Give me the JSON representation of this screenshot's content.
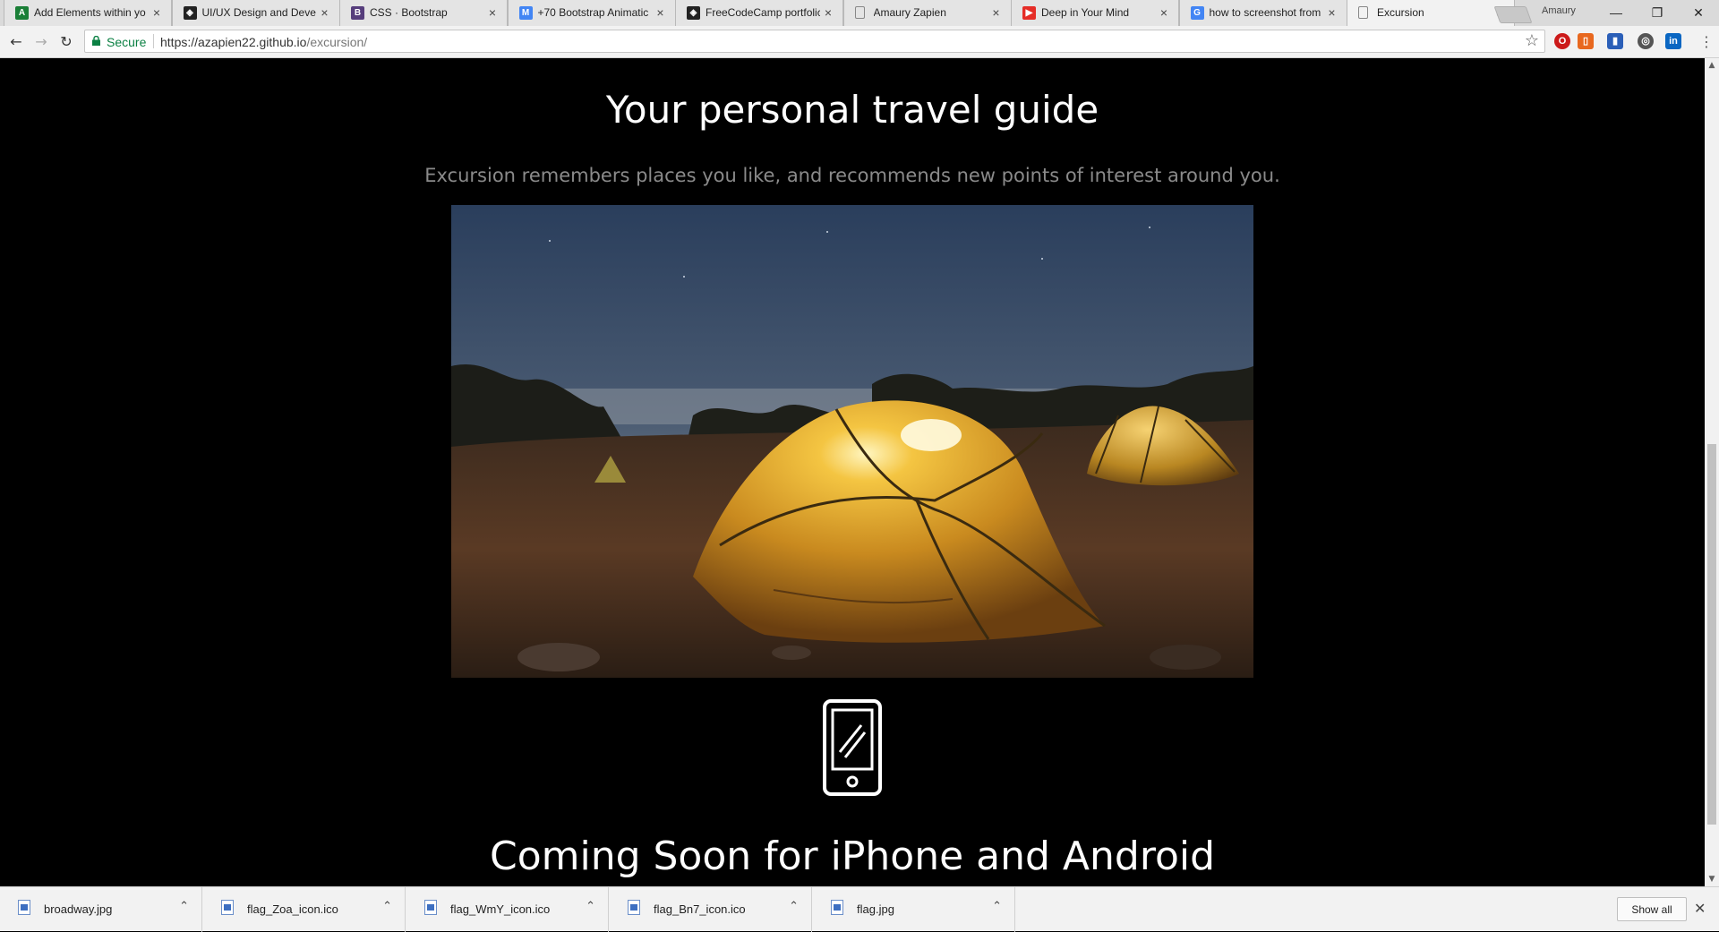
{
  "browser": {
    "tabs": [
      {
        "title": "Add Elements within yo",
        "favicon": "green-spreadsheet-icon",
        "color": "#1a7f37",
        "glyph": "A"
      },
      {
        "title": "UI/UX Design and Deve",
        "favicon": "codepen-icon",
        "color": "#222222",
        "glyph": "◈"
      },
      {
        "title": "CSS · Bootstrap",
        "favicon": "bootstrap-icon",
        "color": "#563d7c",
        "glyph": "B"
      },
      {
        "title": "+70 Bootstrap Animatic",
        "favicon": "mdb-icon",
        "color": "#4285f4",
        "glyph": "M"
      },
      {
        "title": "FreeCodeCamp portfolic",
        "favicon": "codepen-icon",
        "color": "#222222",
        "glyph": "◈"
      },
      {
        "title": "Amaury Zapien",
        "favicon": "page-icon",
        "color": "#888888",
        "glyph": ""
      },
      {
        "title": "Deep in Your Mind",
        "favicon": "youtube-icon",
        "color": "#e52d27",
        "glyph": "▶"
      },
      {
        "title": "how to screenshot from",
        "favicon": "google-icon",
        "color": "#4285f4",
        "glyph": "G"
      },
      {
        "title": "Excursion",
        "favicon": "page-icon",
        "color": "#888888",
        "glyph": ""
      }
    ],
    "active_tab_index": 8,
    "profile_name": "Amaury",
    "window_buttons": {
      "minimize": "—",
      "restore": "❐",
      "close": "✕"
    },
    "address": {
      "secure_label": "Secure",
      "url_host": "https://azapien22.github.io",
      "url_path": "/excursion/"
    }
  },
  "page": {
    "headline": "Your personal travel guide",
    "subheadline": "Excursion remembers places you like, and recommends new points of interest around you.",
    "hero_image": "night-camping-tents-photo",
    "feature_icon": "smartphone-icon",
    "coming_soon": "Coming Soon for iPhone and Android"
  },
  "downloads": {
    "items": [
      {
        "name": "broadway.jpg"
      },
      {
        "name": "flag_Zoa_icon.ico"
      },
      {
        "name": "flag_WmY_icon.ico"
      },
      {
        "name": "flag_Bn7_icon.ico"
      },
      {
        "name": "flag.jpg"
      }
    ],
    "show_all_label": "Show all"
  },
  "colors": {
    "page_background": "#000000",
    "headline": "#ffffff",
    "subheadline": "#8a8a8a",
    "secure_green": "#0b8043"
  }
}
